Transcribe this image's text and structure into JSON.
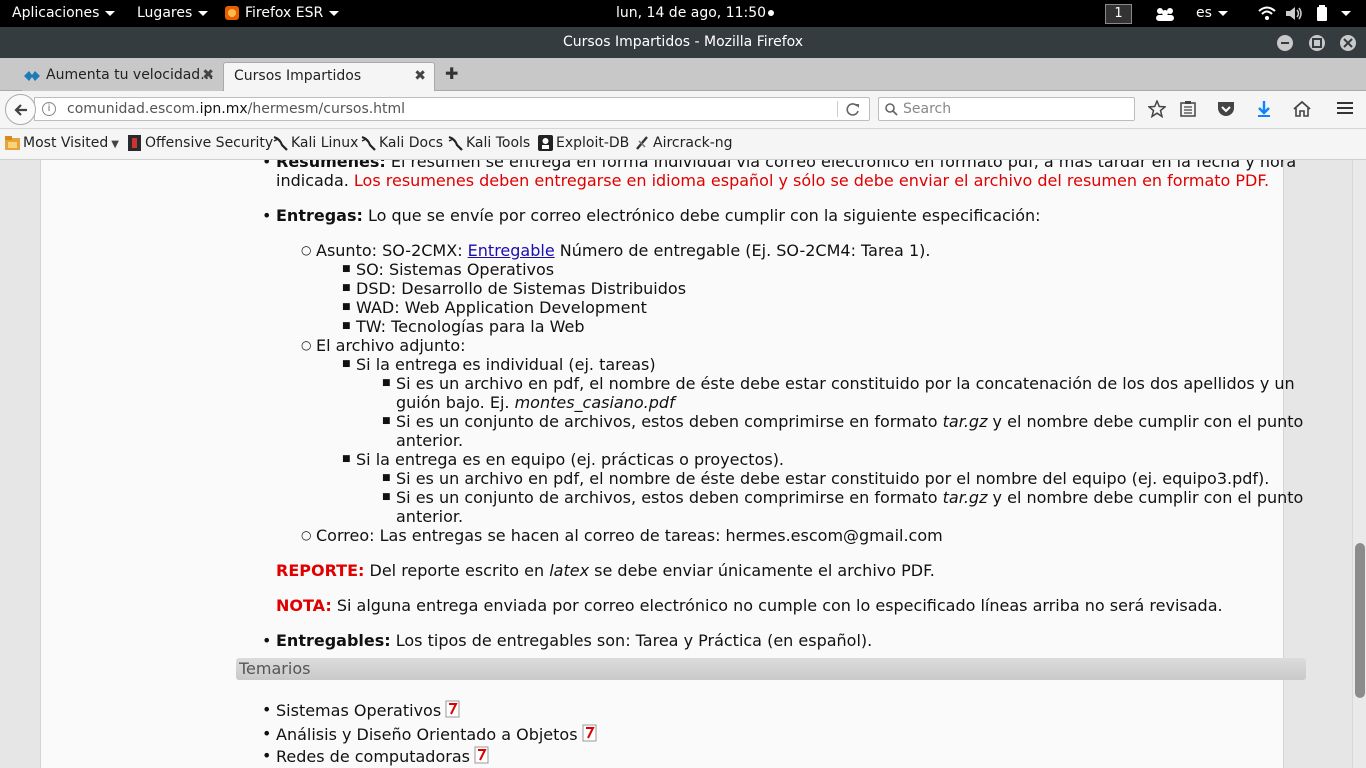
{
  "topbar": {
    "applications": "Aplicaciones",
    "places": "Lugares",
    "app_name": "Firefox ESR",
    "clock": "lun, 14 de ago, 11:50",
    "workspace": "1",
    "language": "es"
  },
  "window": {
    "title": "Cursos Impartidos - Mozilla Firefox"
  },
  "tabs": [
    {
      "label": "Aumenta tu velocidad..."
    },
    {
      "label": "Cursos Impartidos"
    }
  ],
  "navbar": {
    "url_prefix": "comunidad.escom.",
    "url_domain": "ipn.mx",
    "url_path": "/hermesm/cursos.html",
    "search_placeholder": "Search"
  },
  "bookmarks": [
    {
      "label": "Most Visited"
    },
    {
      "label": "Offensive Security"
    },
    {
      "label": "Kali Linux"
    },
    {
      "label": "Kali Docs"
    },
    {
      "label": "Kali Tools"
    },
    {
      "label": "Exploit-DB"
    },
    {
      "label": "Aircrack-ng"
    }
  ],
  "content": {
    "resumenes_label": "Resumenes:",
    "resumenes_text": " El resumen se entrega en forma individual vía correo electrónico en formato pdf, a más tardar en la fecha y hora",
    "resumenes_text2": "indicada. ",
    "resumenes_red": "Los resumenes deben entregarse en idioma español y sólo se debe enviar el archivo del resumen en formato PDF.",
    "entregas_label": "Entregas:",
    "entregas_text": " Lo que se envíe por correo electrónico debe cumplir con la siguiente especificación:",
    "asunto_pre": "Asunto: SO-2CMX: ",
    "asunto_link": "Entregable",
    "asunto_post": " Número de entregable (Ej. SO-2CM4: Tarea 1).",
    "subjects": [
      "SO: Sistemas Operativos",
      "DSD: Desarrollo de Sistemas Distribuidos",
      "WAD: Web Application Development",
      "TW: Tecnologías para la Web"
    ],
    "adjunto": "El archivo adjunto:",
    "individual": "Si la entrega es individual (ej. tareas)",
    "ind_pdf_1": "Si es un archivo en pdf, el nombre de éste debe estar constituido por la concatenación de los dos apellidos y un",
    "ind_pdf_2": "guión bajo. Ej. ",
    "ind_pdf_example": "montes_casiano.pdf",
    "conj_pre": "Si es un conjunto de archivos, estos deben comprimirse en formato ",
    "conj_fmt": "tar.gz",
    "conj_post": " y el nombre debe cumplir con el punto",
    "conj_2": "anterior.",
    "equipo": "Si la entrega es en equipo (ej. prácticas o proyectos).",
    "eq_pdf": "Si es un archivo en pdf, el nombre de éste debe estar constituido por el nombre del equipo (ej. equipo3.pdf).",
    "correo": "Correo: Las entregas se hacen al correo de tareas: hermes.escom@gmail.com",
    "reporte_label": "REPORTE:",
    "reporte_pre": " Del reporte escrito en ",
    "reporte_latex": "latex",
    "reporte_post": " se debe enviar únicamente el archivo PDF.",
    "nota_label": "NOTA:",
    "nota_text": " Si alguna entrega enviada por correo electrónico no cumple con lo especificado líneas arriba no será revisada.",
    "entregables_label": "Entregables:",
    "entregables_text": " Los tipos de entregables son: Tarea y Práctica (en español).",
    "temarios_title": "Temarios",
    "temarios": [
      "Sistemas Operativos",
      "Análisis y Diseño Orientado a Objetos",
      "Redes de computadoras"
    ]
  },
  "colors": {
    "red_text": "#e00000",
    "link": "#1a0dab",
    "topbar": "#000000",
    "titlebar": "#353c3f"
  }
}
